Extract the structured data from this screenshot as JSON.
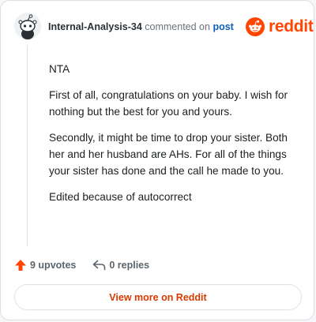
{
  "header": {
    "username": "Internal-Analysis-34",
    "action_text": "commented on",
    "post_link": "post"
  },
  "brand": {
    "wordmark": "reddit",
    "logo_icon": "reddit-snoo-icon",
    "color": "#ff4500"
  },
  "comment": {
    "paragraphs": [
      "NTA",
      "First of all, congratulations on your baby. I wish for nothing but the best for you and yours.",
      "Secondly, it might be time to drop your sister. Both her and her husband are AHs. For all of the things your sister has done and the call he made to you.",
      "Edited because of autocorrect"
    ]
  },
  "actions": {
    "upvotes_label": "9 upvotes",
    "upvote_icon": "upvote-arrow-icon",
    "upvote_color": "#ff4500",
    "replies_label": "0 replies",
    "reply_icon": "reply-arrow-icon"
  },
  "footer": {
    "view_more_label": "View more on Reddit"
  }
}
